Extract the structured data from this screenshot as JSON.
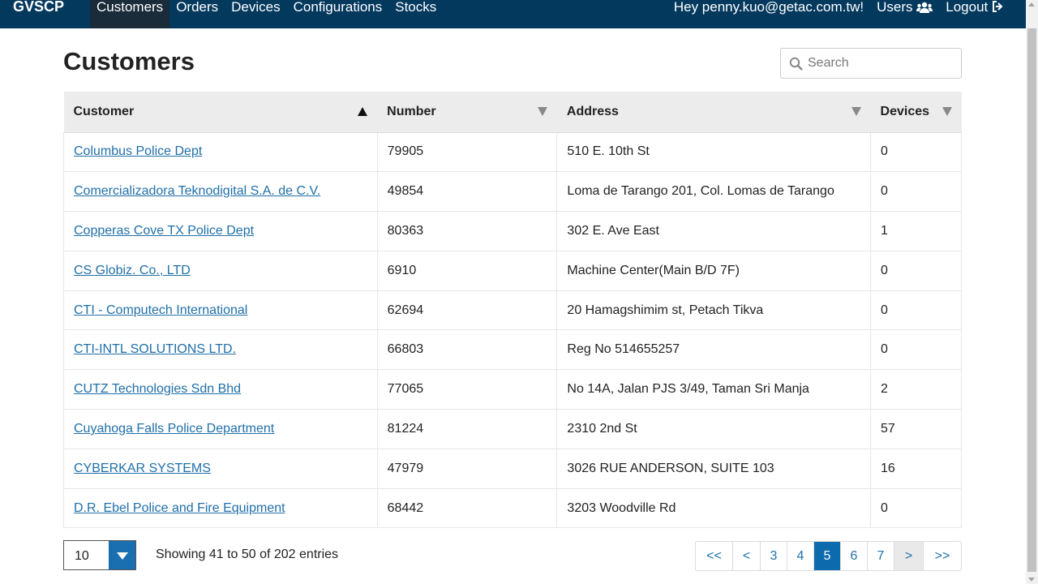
{
  "nav": {
    "brand": "GVSCP",
    "items": [
      "Customers",
      "Orders",
      "Devices",
      "Configurations",
      "Stocks"
    ],
    "greeting": "Hey penny.kuo@getac.com.tw!",
    "users_label": "Users",
    "logout_label": "Logout"
  },
  "page": {
    "title": "Customers"
  },
  "search": {
    "placeholder": "Search",
    "value": ""
  },
  "table": {
    "headers": [
      "Customer",
      "Number",
      "Address",
      "Devices"
    ],
    "rows": [
      [
        "Columbus Police Dept",
        "79905",
        "510 E. 10th St",
        "0"
      ],
      [
        "Comercializadora Teknodigital S.A. de C.V.",
        "49854",
        "Loma de Tarango 201, Col. Lomas de Tarango",
        "0"
      ],
      [
        "Copperas Cove TX Police Dept",
        "80363",
        "302 E. Ave East",
        "1"
      ],
      [
        "CS Globiz. Co., LTD",
        "6910",
        "Machine Center(Main B/D 7F)",
        "0"
      ],
      [
        "CTI - Computech International",
        "62694",
        "20 Hamagshimim st, Petach Tikva",
        "0"
      ],
      [
        "CTI-INTL SOLUTIONS LTD.",
        "66803",
        "Reg No 514655257",
        "0"
      ],
      [
        "CUTZ Technologies Sdn Bhd",
        "77065",
        "No 14A, Jalan PJS 3/49, Taman Sri Manja",
        "2"
      ],
      [
        "Cuyahoga Falls Police Department",
        "81224",
        "2310 2nd St",
        "57"
      ],
      [
        "CYBERKAR SYSTEMS",
        "47979",
        "3026 RUE ANDERSON, SUITE 103",
        "16"
      ],
      [
        "D.R. Ebel Police and Fire Equipment",
        "68442",
        "3203 Woodville Rd",
        "0"
      ]
    ]
  },
  "footer": {
    "page_size": "10",
    "showing": "Showing 41 to 50 of 202 entries",
    "pager": [
      "<<",
      "<",
      "3",
      "4",
      "5",
      "6",
      "7",
      ">",
      ">>"
    ],
    "current_page": "5"
  },
  "colors": {
    "navbar": "#04395e",
    "link": "#1f6fa8",
    "accent": "#0c6aad"
  }
}
